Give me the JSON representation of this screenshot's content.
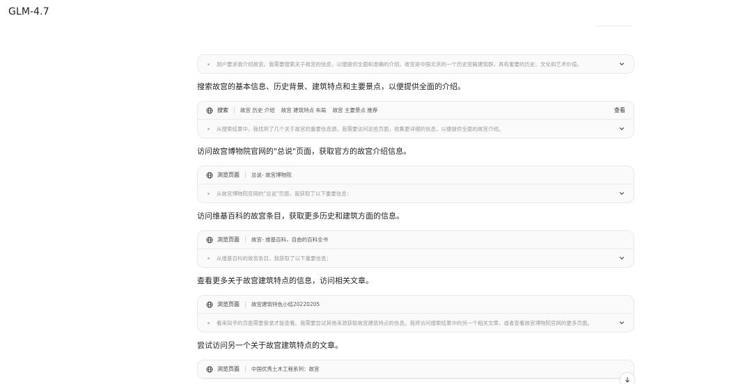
{
  "app": {
    "title": "GLM-4.7"
  },
  "thinking_card": {
    "summary": "用户要求我介绍故宫。我需要搜索关于故宫的信息，以便提供全面和准确的介绍。故宫是中国北京的一个历史宫殿建筑群，具有重要的历史、文化和艺术价值。"
  },
  "steps": [
    {
      "text": "搜索故宫的基本信息、历史背景、建筑特点和主要景点，以便提供全面的介绍。",
      "tool": "搜索",
      "queries": [
        "故宫 历史 介绍",
        "故宫 建筑特点 布局",
        "故宫 主要景点 推荐"
      ],
      "action_label": "查看",
      "result": "从搜索结果中，我找到了几个关于故宫的重要信息源。我需要访问这些页面，收集更详细的信息，以便提供全面的故宫介绍。"
    },
    {
      "text": "访问故宫博物院官网的\"总说\"页面，获取官方的故宫介绍信息。",
      "tool": "浏览页面",
      "page_title": "总说- 故宫博物院",
      "result": "从故宫博物院官网的\"总说\"页面，我获取了以下重要信息："
    },
    {
      "text": "访问维基百科的故宫条目，获取更多历史和建筑方面的信息。",
      "tool": "浏览页面",
      "page_title": "故宫- 维基百科，自由的百科全书",
      "result": "从维基百科的故宫条目，我获取了以下重要信息："
    },
    {
      "text": "查看更多关于故宫建筑特点的信息，访问相关文章。",
      "tool": "浏览页面",
      "page_title": "故宫建筑特色小结20220205",
      "result": "看来知乎的页面需要登录才能查看。我需要尝试其他来源获取故宫建筑特点的信息。我将访问搜索结果中的另一个相关文章，或者查看故宫博物院官网的更多页面。"
    },
    {
      "text": "尝试访问另一个关于故宫建筑特点的文章。",
      "tool": "浏览页面",
      "page_title": "中国优秀土木工程系列：故宫"
    }
  ],
  "icons": {
    "globe": "globe-icon",
    "chevron": "chevron-down-icon",
    "scroll": "arrow-down-icon"
  }
}
